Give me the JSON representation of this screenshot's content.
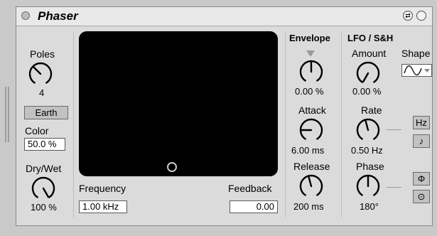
{
  "device": {
    "title": "Phaser",
    "icons": [
      "power-icon",
      "hot-swap-icon",
      "preset-menu-icon"
    ]
  },
  "poles": {
    "label": "Poles",
    "value": "4",
    "level": 0.35
  },
  "earth": {
    "label": "Earth"
  },
  "color": {
    "label": "Color",
    "value": "50.0 %"
  },
  "drywet": {
    "label": "Dry/Wet",
    "value": "100 %",
    "level": 1.0
  },
  "xy": {
    "frequency_label": "Frequency",
    "frequency_value": "1.00 kHz",
    "feedback_label": "Feedback",
    "feedback_value": "0.00"
  },
  "envelope": {
    "heading": "Envelope",
    "amount_value": "0.00 %",
    "amount_level": 0.5,
    "attack_label": "Attack",
    "attack_value": "6.00 ms",
    "attack_level": 0.2,
    "release_label": "Release",
    "release_value": "200 ms",
    "release_level": 0.45
  },
  "lfo": {
    "heading": "LFO / S&H",
    "amount_label": "Amount",
    "amount_value": "0.00 %",
    "amount_level": 0.0,
    "shape_label": "Shape",
    "rate_label": "Rate",
    "rate_value": "0.50 Hz",
    "rate_level": 0.45,
    "hz_label": "Hz",
    "note_symbol": "♪",
    "phase_label": "Phase",
    "phase_value": "180°",
    "phase_level": 0.5,
    "phase_symbol": "Φ",
    "spin_symbol": "⊙"
  }
}
